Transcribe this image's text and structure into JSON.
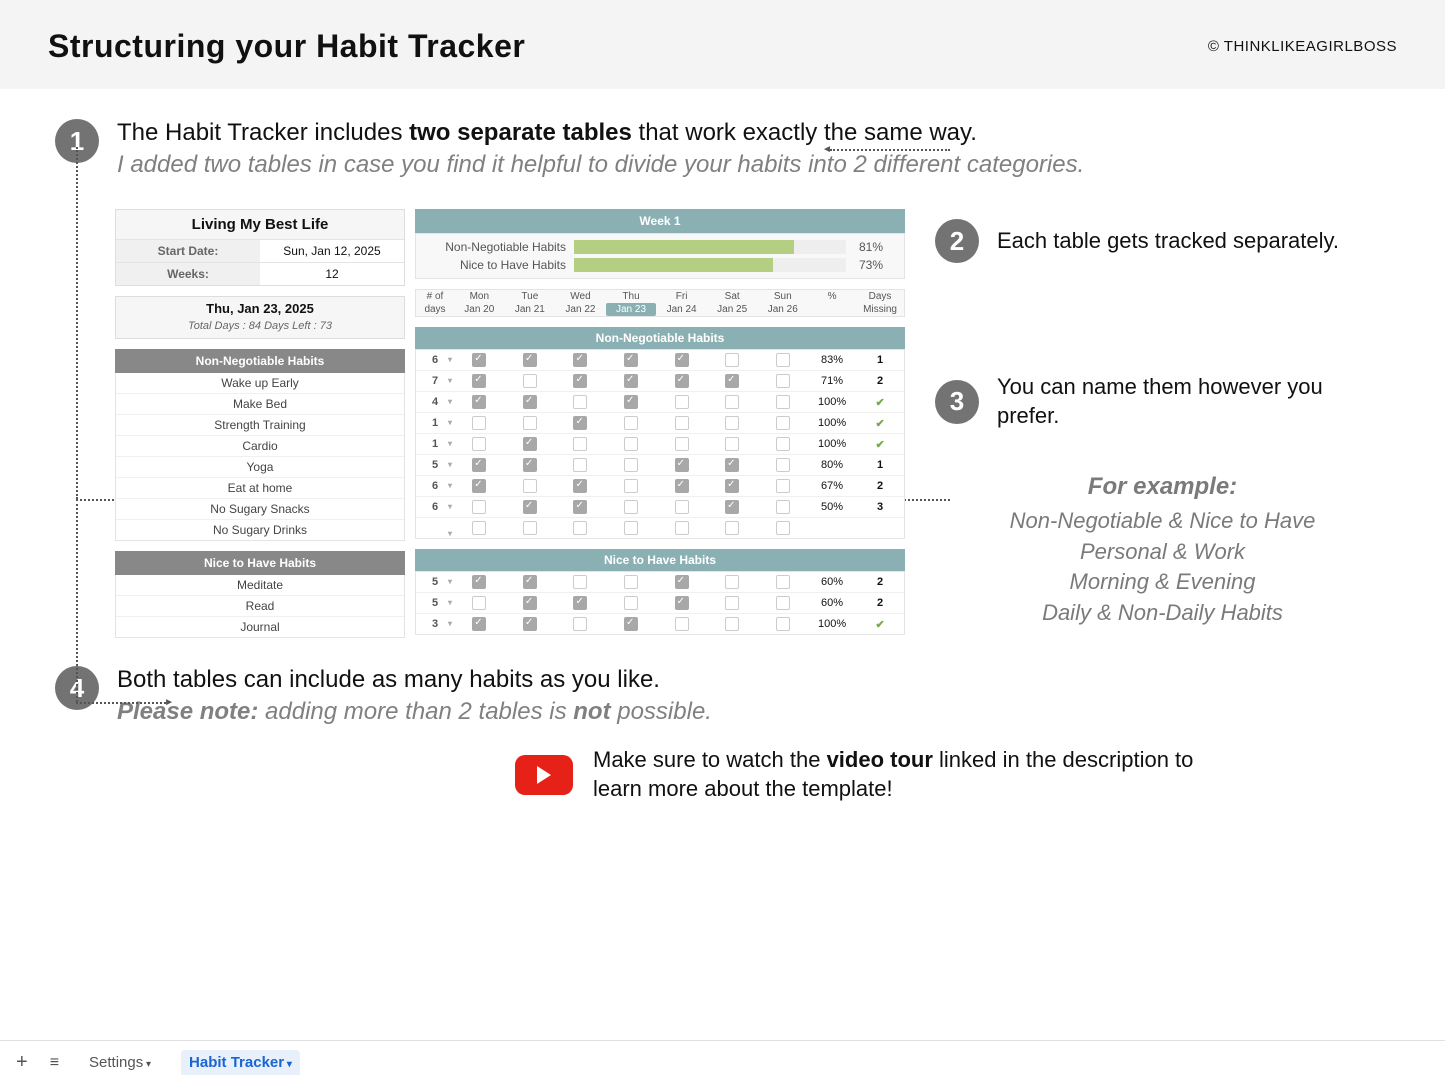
{
  "header": {
    "title": "Structuring your Habit Tracker",
    "copyright": "© THINKLIKEAGIRLBOSS"
  },
  "notes": {
    "n1_main_a": "The Habit Tracker includes ",
    "n1_main_b": "two separate tables",
    "n1_main_c": " that work exactly the same way.",
    "n1_sub": "I added two tables in case you find it helpful to divide your habits into 2 different categories.",
    "n2": "Each table gets tracked separately.",
    "n3": "You can name them however you prefer.",
    "n4_main": "Both tables can include as many habits as you like.",
    "n4_sub_a": "Please note:",
    "n4_sub_b": " adding more than 2 tables is ",
    "n4_sub_c": "not",
    "n4_sub_d": " possible."
  },
  "examples": {
    "head": "For example:",
    "lines": [
      "Non-Negotiable & Nice to Have",
      "Personal & Work",
      "Morning & Evening",
      "Daily & Non-Daily Habits"
    ]
  },
  "cta": {
    "a": "Make sure to watch the ",
    "b": "video tour",
    "c": " linked in the description to learn more about the template!"
  },
  "bottom": {
    "settings": "Settings",
    "active": "Habit Tracker"
  },
  "tracker": {
    "title": "Living My Best Life",
    "start_label": "Start Date:",
    "start_value": "Sun, Jan 12, 2025",
    "weeks_label": "Weeks:",
    "weeks_value": "12",
    "today": "Thu, Jan 23, 2025",
    "stats": "Total Days : 84   Days Left : 73",
    "sec1": "Non-Negotiable Habits",
    "sec2": "Nice to Have Habits",
    "habits1": [
      "Wake up Early",
      "Make Bed",
      "Strength Training",
      "Cardio",
      "Yoga",
      "Eat at home",
      "No Sugary Snacks",
      "No Sugary Drinks"
    ],
    "habits2": [
      "Meditate",
      "Read",
      "Journal"
    ],
    "week_label": "Week 1",
    "progress": [
      {
        "name": "Non-Negotiable Habits",
        "pct": 81
      },
      {
        "name": "Nice to Have Habits",
        "pct": 73
      }
    ],
    "dayhead_top": [
      "# of",
      "Mon",
      "Tue",
      "Wed",
      "Thu",
      "Fri",
      "Sat",
      "Sun",
      "%",
      "Days"
    ],
    "dayhead_sub": [
      "days",
      "Jan 20",
      "Jan 21",
      "Jan 22",
      "Jan 23",
      "Jan 24",
      "Jan 25",
      "Jan 26",
      "",
      "Missing"
    ],
    "grid1": [
      {
        "n": "6",
        "d": [
          1,
          1,
          1,
          1,
          1,
          0,
          0
        ],
        "p": "83%",
        "m": "1"
      },
      {
        "n": "7",
        "d": [
          1,
          0,
          1,
          1,
          1,
          1,
          0
        ],
        "p": "71%",
        "m": "2"
      },
      {
        "n": "4",
        "d": [
          1,
          1,
          0,
          1,
          0,
          0,
          0
        ],
        "p": "100%",
        "m": "✔"
      },
      {
        "n": "1",
        "d": [
          0,
          0,
          1,
          0,
          0,
          0,
          0
        ],
        "p": "100%",
        "m": "✔"
      },
      {
        "n": "1",
        "d": [
          0,
          1,
          0,
          0,
          0,
          0,
          0
        ],
        "p": "100%",
        "m": "✔"
      },
      {
        "n": "5",
        "d": [
          1,
          1,
          0,
          0,
          1,
          1,
          0
        ],
        "p": "80%",
        "m": "1"
      },
      {
        "n": "6",
        "d": [
          1,
          0,
          1,
          0,
          1,
          1,
          0
        ],
        "p": "67%",
        "m": "2"
      },
      {
        "n": "6",
        "d": [
          0,
          1,
          1,
          0,
          0,
          1,
          0
        ],
        "p": "50%",
        "m": "3"
      },
      {
        "n": "",
        "d": [
          0,
          0,
          0,
          0,
          0,
          0,
          0
        ],
        "p": "",
        "m": ""
      }
    ],
    "grid2": [
      {
        "n": "5",
        "d": [
          1,
          1,
          0,
          0,
          1,
          0,
          0
        ],
        "p": "60%",
        "m": "2"
      },
      {
        "n": "5",
        "d": [
          0,
          1,
          1,
          0,
          1,
          0,
          0
        ],
        "p": "60%",
        "m": "2"
      },
      {
        "n": "3",
        "d": [
          1,
          1,
          0,
          1,
          0,
          0,
          0
        ],
        "p": "100%",
        "m": "✔"
      }
    ]
  }
}
